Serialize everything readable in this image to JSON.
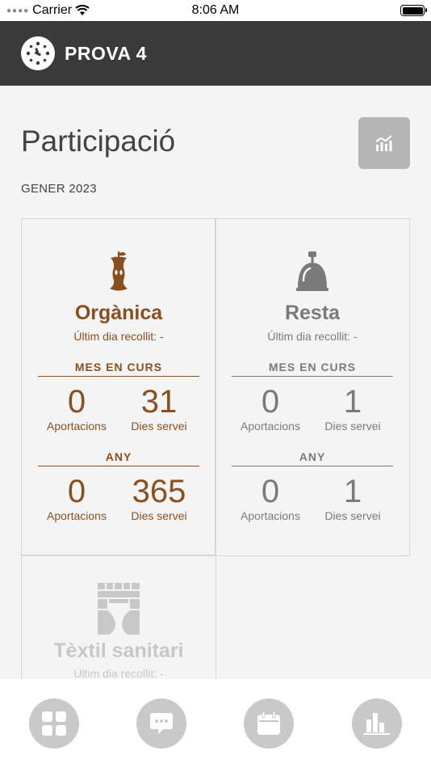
{
  "status_bar": {
    "carrier": "Carrier",
    "time": "8:06 AM"
  },
  "header": {
    "title": "PROVA 4"
  },
  "page": {
    "title": "Participació",
    "period": "GENER 2023"
  },
  "colors": {
    "header_bg": "#3a3a3a",
    "organic": "#8b4f1f",
    "rest": "#7a7a7a",
    "textile": "#c8c8c8",
    "nav_button": "#c9c9cc"
  },
  "cards": [
    {
      "name": "Orgànica",
      "icon": "apple-core-icon",
      "last_collection": "Últim dia recollit: -",
      "month": {
        "heading": "MES EN CURS",
        "contributions": "0",
        "contributions_label": "Aportacions",
        "service_days": "31",
        "service_days_label": "Dies servei"
      },
      "year": {
        "heading": "ANY",
        "contributions": "0",
        "contributions_label": "Aportacions",
        "service_days": "365",
        "service_days_label": "Dies servei"
      }
    },
    {
      "name": "Resta",
      "icon": "cloche-icon",
      "last_collection": "Últim dia recollit: -",
      "month": {
        "heading": "MES EN CURS",
        "contributions": "0",
        "contributions_label": "Aportacions",
        "service_days": "1",
        "service_days_label": "Dies servei"
      },
      "year": {
        "heading": "ANY",
        "contributions": "0",
        "contributions_label": "Aportacions",
        "service_days": "1",
        "service_days_label": "Dies servei"
      }
    },
    {
      "name": "Tèxtil sanitari",
      "icon": "diaper-icon",
      "last_collection": "Últim dia recollit: -"
    }
  ],
  "nav": [
    {
      "icon": "grid-icon"
    },
    {
      "icon": "chat-icon"
    },
    {
      "icon": "calendar-icon"
    },
    {
      "icon": "bar-chart-icon"
    }
  ]
}
